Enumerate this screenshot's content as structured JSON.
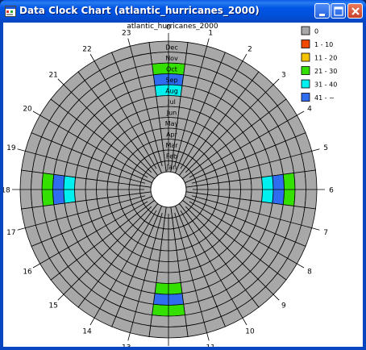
{
  "window": {
    "title": "Data Clock Chart (atlantic_hurricanes_2000)",
    "titlebar_color": "#0055e5"
  },
  "buttons": {
    "minimize_icon": "minimize-icon",
    "maximize_icon": "maximize-icon",
    "close_icon": "close-icon"
  },
  "chart_data": {
    "type": "heatmap",
    "title": "atlantic_hurricanes_2000",
    "hours": [
      "0",
      "1",
      "2",
      "3",
      "4",
      "5",
      "6",
      "7",
      "8",
      "9",
      "10",
      "11",
      "12",
      "13",
      "14",
      "15",
      "16",
      "17",
      "18",
      "19",
      "20",
      "21",
      "22",
      "23"
    ],
    "months": [
      "Jan",
      "Feb",
      "Mar",
      "Apr",
      "May",
      "Jun",
      "Jul",
      "Aug",
      "Sep",
      "Oct",
      "Nov",
      "Dec"
    ],
    "legend": [
      {
        "label": "0",
        "color": "#a8a8a8"
      },
      {
        "label": "1 - 10",
        "color": "#f04a00"
      },
      {
        "label": "11 - 20",
        "color": "#f5c400"
      },
      {
        "label": "21 - 30",
        "color": "#33e000"
      },
      {
        "label": "31 - 40",
        "color": "#00f0f0"
      },
      {
        "label": "41 - ~",
        "color": "#2f6cf0"
      }
    ],
    "cells": [
      {
        "hour": 0,
        "month": "Aug",
        "bin": 4
      },
      {
        "hour": 0,
        "month": "Sep",
        "bin": 5
      },
      {
        "hour": 0,
        "month": "Oct",
        "bin": 3
      },
      {
        "hour": 6,
        "month": "Aug",
        "bin": 4
      },
      {
        "hour": 6,
        "month": "Sep",
        "bin": 5
      },
      {
        "hour": 6,
        "month": "Oct",
        "bin": 3
      },
      {
        "hour": 12,
        "month": "Aug",
        "bin": 3
      },
      {
        "hour": 12,
        "month": "Sep",
        "bin": 5
      },
      {
        "hour": 12,
        "month": "Oct",
        "bin": 3
      },
      {
        "hour": 18,
        "month": "Aug",
        "bin": 4
      },
      {
        "hour": 18,
        "month": "Sep",
        "bin": 5
      },
      {
        "hour": 18,
        "month": "Oct",
        "bin": 3
      }
    ],
    "default_bin": 0
  }
}
